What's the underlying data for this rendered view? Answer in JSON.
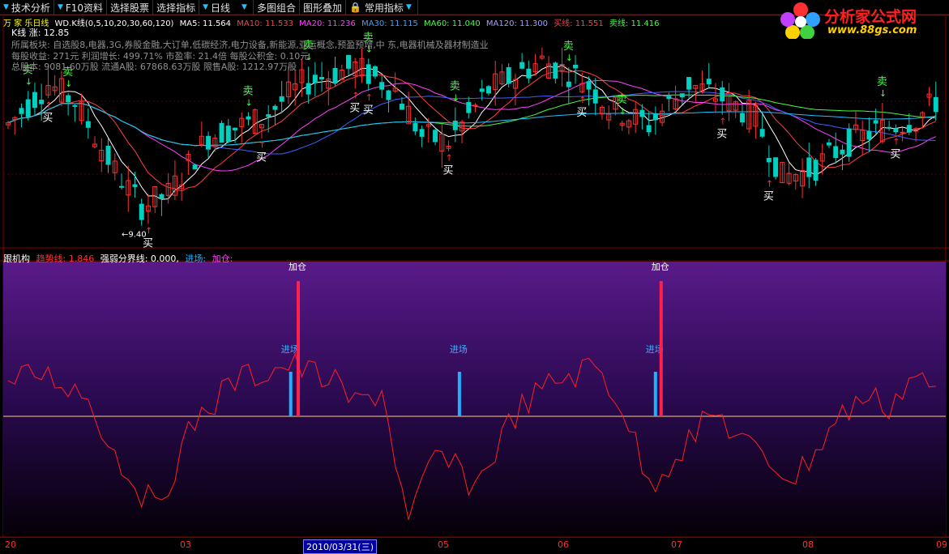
{
  "toolbar": {
    "items": [
      "技术分析",
      "F10资料",
      "选择股票",
      "选择指标",
      "日线",
      "多图组合",
      "图形叠加",
      "常用指标"
    ]
  },
  "logo": {
    "name": "分析家公式网",
    "url": "www.88gs.com"
  },
  "main_header": {
    "stock": "万 家 乐日线",
    "formula": "WD.K线(0,5,10,20,30,60,120)",
    "ma5": "MA5: 11.564",
    "ma10": "MA10: 11.533",
    "ma20": "MA20: 11.236",
    "ma30": "MA30: 11.115",
    "ma60": "MA60: 11.040",
    "ma120": "MA120: 11.300",
    "buyline": "买线: 11.551",
    "sellline": "卖线: 11.416"
  },
  "info_lines": [
    "K线 涨: 12.85",
    "所属板块: 自选股8,电器,3G,券股金融,大订单,低碳经济,电力设备,新能源,亚运概念,预盈预增,中 东,电器机械及器材制造业",
    "每股收益: 271元   利润增长: 499.71%   市盈率: 21.4倍   每股公积金: 0.10元",
    "总股本: 9081.60万股   流通A股: 67868.63万股   限售A股: 1212.97万股"
  ],
  "low_label": "←9.40",
  "buy_label": "买",
  "sell_label": "卖",
  "indicator_header": {
    "name": "跟机构",
    "trend": "趋势线: 1.846",
    "divider": "强弱分界线: 0.000,",
    "entry": "进场:",
    "add": "加仓:"
  },
  "signal_labels": {
    "add": "加仓",
    "entry": "进场"
  },
  "x_axis": {
    "labels": [
      "20",
      "03",
      "05",
      "06",
      "07",
      "08",
      "09"
    ],
    "selected_date": "2010/03/31(三)"
  },
  "colors": {
    "up": "#ff3030",
    "down": "#00e0e0",
    "ma5": "#ffffff",
    "ma10": "#ffd700",
    "ma20": "#ff40ff",
    "ma30": "#40ff40",
    "ma60": "#20c0ff",
    "ma120": "#c0c0c0",
    "trend": "#ff2020",
    "entry": "#20b0ff",
    "add": "#ff2050"
  },
  "chart_data": [
    {
      "type": "candlestick",
      "title": "万家乐 日线",
      "series": [
        {
          "name": "MA5",
          "last": 11.564
        },
        {
          "name": "MA10",
          "last": 11.533
        },
        {
          "name": "MA20",
          "last": 11.236
        },
        {
          "name": "MA30",
          "last": 11.115
        },
        {
          "name": "MA60",
          "last": 11.04
        },
        {
          "name": "MA120",
          "last": 11.3
        },
        {
          "name": "买线",
          "last": 11.551
        },
        {
          "name": "卖线",
          "last": 11.416
        }
      ],
      "annotations": {
        "low": 9.4
      }
    },
    {
      "type": "line",
      "title": "跟机构",
      "series": [
        {
          "name": "趋势线",
          "last": 1.846
        },
        {
          "name": "强弱分界线",
          "last": 0.0
        }
      ],
      "signals": [
        {
          "type": "进场",
          "x_fraction": 0.305
        },
        {
          "type": "加仓",
          "x_fraction": 0.313
        },
        {
          "type": "进场",
          "x_fraction": 0.484
        },
        {
          "type": "进场",
          "x_fraction": 0.692
        },
        {
          "type": "加仓",
          "x_fraction": 0.698
        }
      ]
    }
  ]
}
